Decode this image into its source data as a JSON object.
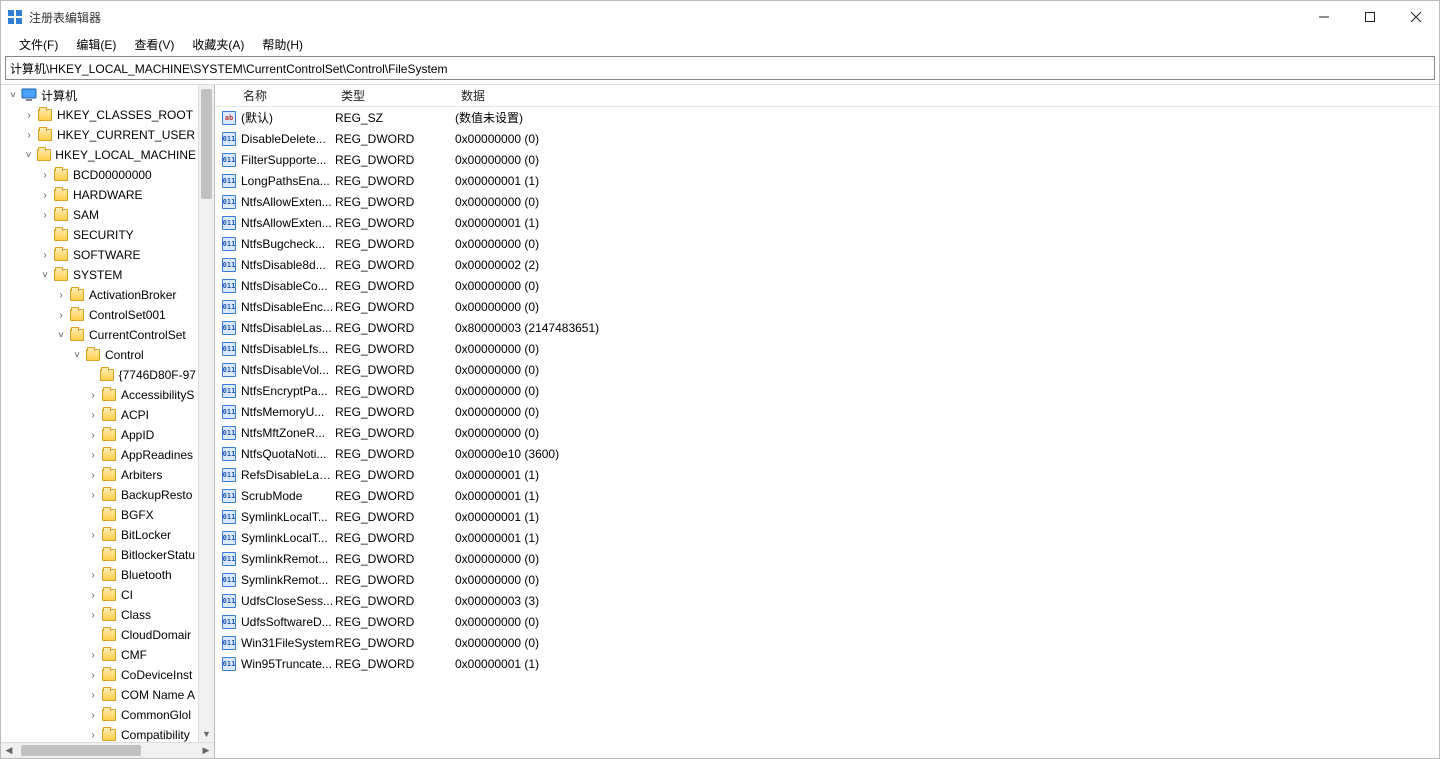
{
  "window": {
    "title": "注册表编辑器"
  },
  "menu": {
    "file": "文件(F)",
    "edit": "编辑(E)",
    "view": "查看(V)",
    "favorites": "收藏夹(A)",
    "help": "帮助(H)"
  },
  "address": "计算机\\HKEY_LOCAL_MACHINE\\SYSTEM\\CurrentControlSet\\Control\\FileSystem",
  "tree": [
    {
      "depth": 0,
      "chev": "v",
      "icon": "pc",
      "label": "计算机"
    },
    {
      "depth": 1,
      "chev": ">",
      "icon": "folder",
      "label": "HKEY_CLASSES_ROOT"
    },
    {
      "depth": 1,
      "chev": ">",
      "icon": "folder",
      "label": "HKEY_CURRENT_USER"
    },
    {
      "depth": 1,
      "chev": "v",
      "icon": "folder",
      "label": "HKEY_LOCAL_MACHINE"
    },
    {
      "depth": 2,
      "chev": ">",
      "icon": "folder",
      "label": "BCD00000000"
    },
    {
      "depth": 2,
      "chev": ">",
      "icon": "folder",
      "label": "HARDWARE"
    },
    {
      "depth": 2,
      "chev": ">",
      "icon": "folder",
      "label": "SAM"
    },
    {
      "depth": 2,
      "chev": "",
      "icon": "folder",
      "label": "SECURITY"
    },
    {
      "depth": 2,
      "chev": ">",
      "icon": "folder",
      "label": "SOFTWARE"
    },
    {
      "depth": 2,
      "chev": "v",
      "icon": "folder",
      "label": "SYSTEM"
    },
    {
      "depth": 3,
      "chev": ">",
      "icon": "folder",
      "label": "ActivationBroker"
    },
    {
      "depth": 3,
      "chev": ">",
      "icon": "folder",
      "label": "ControlSet001"
    },
    {
      "depth": 3,
      "chev": "v",
      "icon": "folder",
      "label": "CurrentControlSet"
    },
    {
      "depth": 4,
      "chev": "v",
      "icon": "folder",
      "label": "Control"
    },
    {
      "depth": 5,
      "chev": "",
      "icon": "folder",
      "label": "{7746D80F-97"
    },
    {
      "depth": 5,
      "chev": ">",
      "icon": "folder",
      "label": "AccessibilityS"
    },
    {
      "depth": 5,
      "chev": ">",
      "icon": "folder",
      "label": "ACPI"
    },
    {
      "depth": 5,
      "chev": ">",
      "icon": "folder",
      "label": "AppID"
    },
    {
      "depth": 5,
      "chev": ">",
      "icon": "folder",
      "label": "AppReadines"
    },
    {
      "depth": 5,
      "chev": ">",
      "icon": "folder",
      "label": "Arbiters"
    },
    {
      "depth": 5,
      "chev": ">",
      "icon": "folder",
      "label": "BackupResto"
    },
    {
      "depth": 5,
      "chev": "",
      "icon": "folder",
      "label": "BGFX"
    },
    {
      "depth": 5,
      "chev": ">",
      "icon": "folder",
      "label": "BitLocker"
    },
    {
      "depth": 5,
      "chev": "",
      "icon": "folder",
      "label": "BitlockerStatu"
    },
    {
      "depth": 5,
      "chev": ">",
      "icon": "folder",
      "label": "Bluetooth"
    },
    {
      "depth": 5,
      "chev": ">",
      "icon": "folder",
      "label": "CI"
    },
    {
      "depth": 5,
      "chev": ">",
      "icon": "folder",
      "label": "Class"
    },
    {
      "depth": 5,
      "chev": "",
      "icon": "folder",
      "label": "CloudDomair"
    },
    {
      "depth": 5,
      "chev": ">",
      "icon": "folder",
      "label": "CMF"
    },
    {
      "depth": 5,
      "chev": ">",
      "icon": "folder",
      "label": "CoDeviceInst"
    },
    {
      "depth": 5,
      "chev": ">",
      "icon": "folder",
      "label": "COM Name A"
    },
    {
      "depth": 5,
      "chev": ">",
      "icon": "folder",
      "label": "CommonGlol"
    },
    {
      "depth": 5,
      "chev": ">",
      "icon": "folder",
      "label": "Compatibility"
    }
  ],
  "columns": {
    "name": "名称",
    "type": "类型",
    "data": "数据"
  },
  "values": [
    {
      "icon": "sz",
      "name": "(默认)",
      "type": "REG_SZ",
      "data": "(数值未设置)"
    },
    {
      "icon": "dw",
      "name": "DisableDelete...",
      "type": "REG_DWORD",
      "data": "0x00000000 (0)"
    },
    {
      "icon": "dw",
      "name": "FilterSupporte...",
      "type": "REG_DWORD",
      "data": "0x00000000 (0)"
    },
    {
      "icon": "dw",
      "name": "LongPathsEna...",
      "type": "REG_DWORD",
      "data": "0x00000001 (1)"
    },
    {
      "icon": "dw",
      "name": "NtfsAllowExten...",
      "type": "REG_DWORD",
      "data": "0x00000000 (0)"
    },
    {
      "icon": "dw",
      "name": "NtfsAllowExten...",
      "type": "REG_DWORD",
      "data": "0x00000001 (1)"
    },
    {
      "icon": "dw",
      "name": "NtfsBugcheck...",
      "type": "REG_DWORD",
      "data": "0x00000000 (0)"
    },
    {
      "icon": "dw",
      "name": "NtfsDisable8d...",
      "type": "REG_DWORD",
      "data": "0x00000002 (2)"
    },
    {
      "icon": "dw",
      "name": "NtfsDisableCo...",
      "type": "REG_DWORD",
      "data": "0x00000000 (0)"
    },
    {
      "icon": "dw",
      "name": "NtfsDisableEnc...",
      "type": "REG_DWORD",
      "data": "0x00000000 (0)"
    },
    {
      "icon": "dw",
      "name": "NtfsDisableLas...",
      "type": "REG_DWORD",
      "data": "0x80000003 (2147483651)"
    },
    {
      "icon": "dw",
      "name": "NtfsDisableLfs...",
      "type": "REG_DWORD",
      "data": "0x00000000 (0)"
    },
    {
      "icon": "dw",
      "name": "NtfsDisableVol...",
      "type": "REG_DWORD",
      "data": "0x00000000 (0)"
    },
    {
      "icon": "dw",
      "name": "NtfsEncryptPa...",
      "type": "REG_DWORD",
      "data": "0x00000000 (0)"
    },
    {
      "icon": "dw",
      "name": "NtfsMemoryU...",
      "type": "REG_DWORD",
      "data": "0x00000000 (0)"
    },
    {
      "icon": "dw",
      "name": "NtfsMftZoneR...",
      "type": "REG_DWORD",
      "data": "0x00000000 (0)"
    },
    {
      "icon": "dw",
      "name": "NtfsQuotaNoti...",
      "type": "REG_DWORD",
      "data": "0x00000e10 (3600)"
    },
    {
      "icon": "dw",
      "name": "RefsDisableLas...",
      "type": "REG_DWORD",
      "data": "0x00000001 (1)"
    },
    {
      "icon": "dw",
      "name": "ScrubMode",
      "type": "REG_DWORD",
      "data": "0x00000001 (1)"
    },
    {
      "icon": "dw",
      "name": "SymlinkLocalT...",
      "type": "REG_DWORD",
      "data": "0x00000001 (1)"
    },
    {
      "icon": "dw",
      "name": "SymlinkLocalT...",
      "type": "REG_DWORD",
      "data": "0x00000001 (1)"
    },
    {
      "icon": "dw",
      "name": "SymlinkRemot...",
      "type": "REG_DWORD",
      "data": "0x00000000 (0)"
    },
    {
      "icon": "dw",
      "name": "SymlinkRemot...",
      "type": "REG_DWORD",
      "data": "0x00000000 (0)"
    },
    {
      "icon": "dw",
      "name": "UdfsCloseSess...",
      "type": "REG_DWORD",
      "data": "0x00000003 (3)"
    },
    {
      "icon": "dw",
      "name": "UdfsSoftwareD...",
      "type": "REG_DWORD",
      "data": "0x00000000 (0)"
    },
    {
      "icon": "dw",
      "name": "Win31FileSystem",
      "type": "REG_DWORD",
      "data": "0x00000000 (0)"
    },
    {
      "icon": "dw",
      "name": "Win95Truncate...",
      "type": "REG_DWORD",
      "data": "0x00000001 (1)"
    }
  ]
}
